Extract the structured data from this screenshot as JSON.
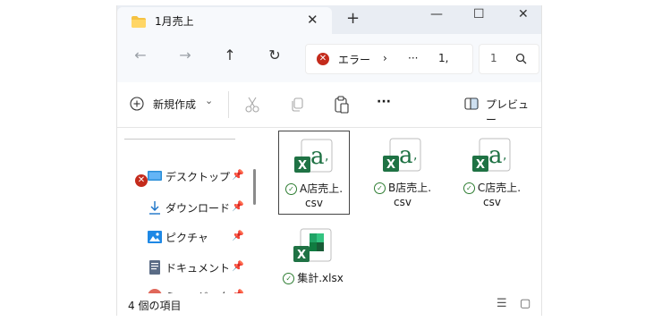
{
  "window": {
    "tab_title": "1月売上",
    "tab_close": "✕",
    "new_tab": "+"
  },
  "controls": {
    "minimize": "—",
    "maximize": "☐",
    "close": "✕"
  },
  "nav": {
    "back": "←",
    "forward": "→",
    "up": "↑",
    "refresh": "↻"
  },
  "address": {
    "error_symbol": "✕",
    "segments": [
      "エラー",
      "›",
      "···",
      "1,"
    ]
  },
  "search": {
    "text": "1",
    "icon": "search-icon"
  },
  "toolbar": {
    "new_label": "新規作成",
    "new_chevron": "⌄",
    "more": "···",
    "preview_label": "プレビュー"
  },
  "sidebar": {
    "items": [
      {
        "label": "デスクトップ",
        "icon": "desktop-icon",
        "pin": "📌"
      },
      {
        "label": "ダウンロード",
        "icon": "download-icon",
        "pin": "📌"
      },
      {
        "label": "ピクチャ",
        "icon": "pictures-icon",
        "pin": "📌"
      },
      {
        "label": "ドキュメント",
        "icon": "documents-icon",
        "pin": "📌"
      },
      {
        "label": "ミュージック",
        "icon": "music-icon",
        "pin": "📌"
      }
    ],
    "error_symbol": "✕"
  },
  "files": [
    {
      "line1": "A店売上.",
      "line2": "csv",
      "type": "csv",
      "check": "✓"
    },
    {
      "line1": "B店売上.",
      "line2": "csv",
      "type": "csv",
      "check": "✓"
    },
    {
      "line1": "C店売上.",
      "line2": "csv",
      "type": "csv",
      "check": "✓"
    },
    {
      "line1": "集計.xlsx",
      "line2": "",
      "type": "xlsx",
      "check": "✓"
    }
  ],
  "status": {
    "item_count": "4 個の項目",
    "view_details": "☰",
    "view_tiles": "▢"
  },
  "colors": {
    "excel_green": "#1f7244",
    "error_red": "#c42b1c",
    "tab_bg": "#e9edf3"
  }
}
